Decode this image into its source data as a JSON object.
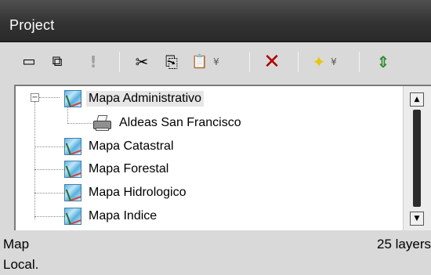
{
  "window": {
    "title": "Project"
  },
  "toolbar": {
    "icons": {
      "restore": "restore-window-icon",
      "maximize": "maximize-window-icon",
      "properties": "properties-icon",
      "cut": "cut-icon",
      "copy": "copy-icon",
      "paste": "paste-icon",
      "delete": "delete-icon",
      "add": "add-layer-icon",
      "refresh": "refresh-icon"
    },
    "glyphs": {
      "restore": "▭",
      "maximize": "⧉",
      "properties": "!",
      "cut": "✂",
      "copy": "⎘",
      "paste": "📋",
      "delete": "✕",
      "add": "✦",
      "dropdown": "¥",
      "refresh": "⇕"
    }
  },
  "tree": {
    "items": [
      {
        "label": "Mapa Administrativo",
        "icon": "map-layer-icon",
        "expanded": true,
        "selected": true
      },
      {
        "label": "Aldeas San Francisco",
        "icon": "printer-icon",
        "child": true
      },
      {
        "label": "Mapa Catastral",
        "icon": "map-layer-icon"
      },
      {
        "label": "Mapa Forestal",
        "icon": "map-layer-icon"
      },
      {
        "label": "Mapa Hidrologico",
        "icon": "map-layer-icon"
      },
      {
        "label": "Mapa Indice",
        "icon": "map-layer-icon"
      }
    ],
    "expander_glyph": "−"
  },
  "scrollbar": {
    "up": "▲",
    "down": "▼"
  },
  "status": {
    "type": "Map",
    "count": "25 layers",
    "location": "Local."
  },
  "colors": {
    "title_bar": "#333333",
    "panel_bg": "#d9d9d9",
    "delete_icon": "#b00000",
    "add_icon": "#e8c600",
    "refresh_icon": "#2f8f2f"
  }
}
